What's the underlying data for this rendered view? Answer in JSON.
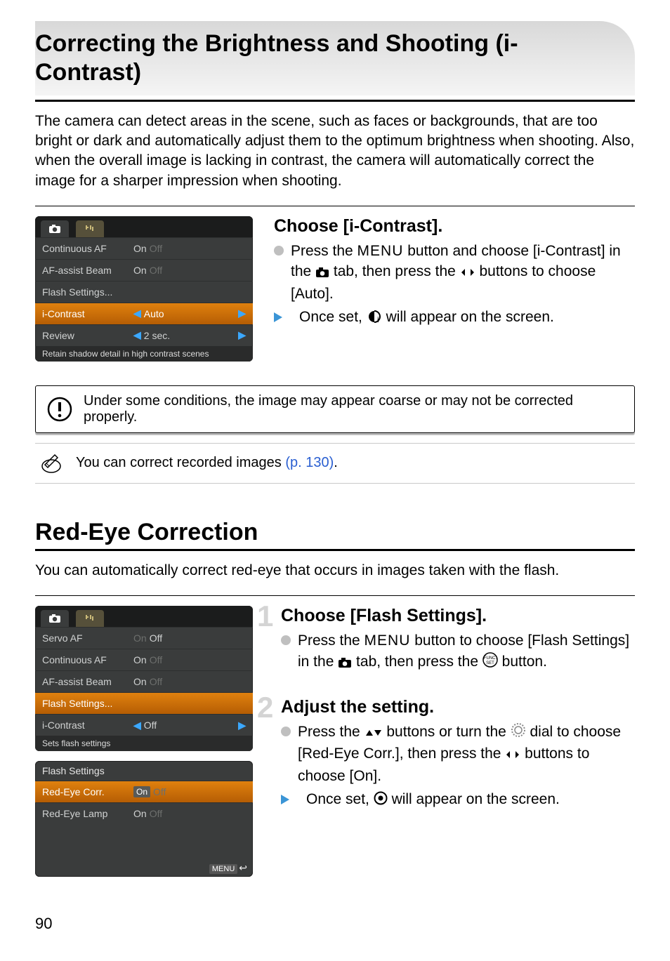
{
  "page_number": "90",
  "section1": {
    "title": "Correcting the Brightness and Shooting (i-Contrast)",
    "intro": "The camera can detect areas in the scene, such as faces or backgrounds, that are too bright or dark and automatically adjust them to the optimum brightness when shooting. Also, when the overall image is lacking in contrast, the camera will automatically correct the image for a sharper impression when shooting.",
    "step_title": "Choose [i-Contrast].",
    "step_line1a": "Press the ",
    "step_line1_menu": "MENU",
    "step_line1b": " button and choose [i-Contrast] in the ",
    "step_line1c": " tab, then press the ",
    "step_line1d": " buttons to choose [Auto].",
    "step_line2a": "Once set, ",
    "step_line2b": " will appear on the screen.",
    "callout_warn": "Under some conditions, the image may appear coarse or may not be corrected properly.",
    "callout_tip_a": "You can correct recorded images ",
    "callout_tip_link": "(p. 130)",
    "callout_tip_b": ".",
    "menu": {
      "rows": [
        {
          "label": "Continuous AF",
          "value": "On",
          "dim": "Off"
        },
        {
          "label": "AF-assist Beam",
          "value": "On",
          "dim": "Off"
        },
        {
          "label": "Flash Settings...",
          "value": "",
          "dim": ""
        },
        {
          "label": "i-Contrast",
          "value": "Auto",
          "selected": true,
          "arrows": true
        },
        {
          "label": "Review",
          "value": "2 sec.",
          "arrows_left": true,
          "arrow_right": true
        }
      ],
      "help": "Retain shadow detail in high contrast scenes"
    }
  },
  "section2": {
    "title": "Red-Eye Correction",
    "intro": "You can automatically correct red-eye that occurs in images taken with the flash.",
    "step1_num": "1",
    "step1_title": "Choose [Flash Settings].",
    "step1_a": "Press the ",
    "step1_menu": "MENU",
    "step1_b": " button to choose [Flash Settings] in the ",
    "step1_c": " tab, then press the ",
    "step1_d": " button.",
    "step2_num": "2",
    "step2_title": "Adjust the setting.",
    "step2_a": "Press the ",
    "step2_b": " buttons or turn the ",
    "step2_c": " dial to choose [Red-Eye Corr.], then press the ",
    "step2_d": " buttons to choose [On].",
    "step2_e": "Once set, ",
    "step2_f": " will appear on the screen.",
    "menu1": {
      "rows": [
        {
          "label": "Servo AF",
          "dim_left": "On",
          "value": "Off"
        },
        {
          "label": "Continuous AF",
          "value": "On",
          "dim": "Off"
        },
        {
          "label": "AF-assist Beam",
          "value": "On",
          "dim": "Off"
        },
        {
          "label": "Flash Settings...",
          "selected": true
        },
        {
          "label": "i-Contrast",
          "value": "Off",
          "arrows_left": true,
          "arrow_right": true
        }
      ],
      "help": "Sets flash settings"
    },
    "menu2": {
      "title": "Flash Settings",
      "rows": [
        {
          "label": "Red-Eye Corr.",
          "on_pill": "On",
          "dim": "Off",
          "selected": true
        },
        {
          "label": "Red-Eye Lamp",
          "value": "On",
          "dim": "Off"
        }
      ],
      "footer_badge": "MENU"
    }
  }
}
